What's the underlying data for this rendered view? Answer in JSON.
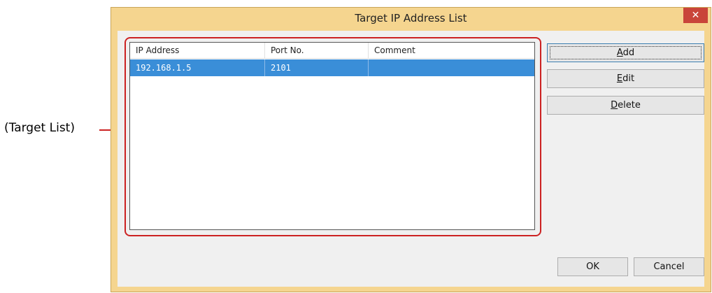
{
  "callout": {
    "label": "(Target List)"
  },
  "dialog": {
    "title": "Target IP Address List",
    "close_glyph": "✕"
  },
  "list": {
    "columns": [
      "IP Address",
      "Port No.",
      "Comment"
    ],
    "rows": [
      {
        "ip": "192.168.1.5",
        "port": "2101",
        "comment": "",
        "selected": true
      }
    ]
  },
  "buttons": {
    "add": {
      "mnemonic": "A",
      "rest": "dd"
    },
    "edit": {
      "mnemonic": "E",
      "rest": "dit"
    },
    "delete": {
      "mnemonic": "D",
      "rest": "elete"
    },
    "ok": "OK",
    "cancel": "Cancel"
  },
  "colors": {
    "frame": "#f5d58f",
    "selection": "#3a8ed8",
    "callout": "#cc2222",
    "close": "#c9453a"
  }
}
